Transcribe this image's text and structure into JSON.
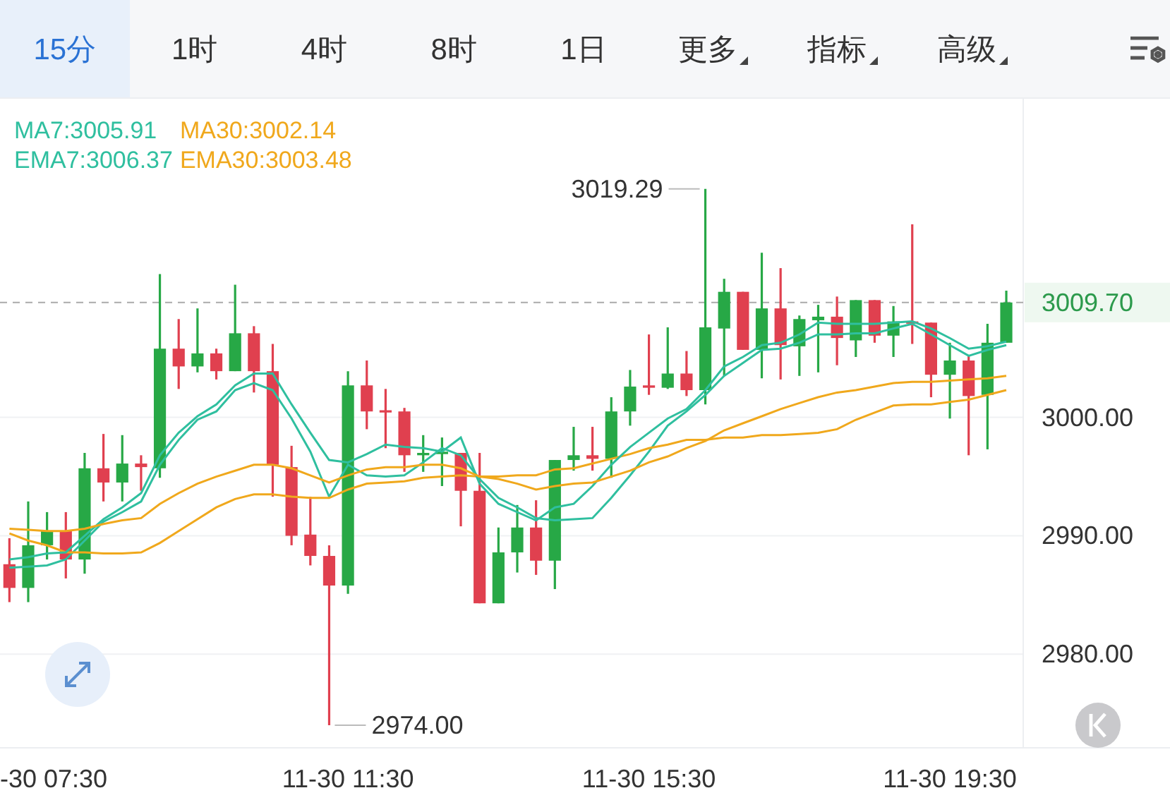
{
  "tabs": [
    {
      "label": "15分",
      "selected": true,
      "dropdown": false
    },
    {
      "label": "1时",
      "selected": false,
      "dropdown": false
    },
    {
      "label": "4时",
      "selected": false,
      "dropdown": false
    },
    {
      "label": "8时",
      "selected": false,
      "dropdown": false
    },
    {
      "label": "1日",
      "selected": false,
      "dropdown": false
    },
    {
      "label": "更多",
      "selected": false,
      "dropdown": true
    },
    {
      "label": "指标",
      "selected": false,
      "dropdown": true
    },
    {
      "label": "高级",
      "selected": false,
      "dropdown": true
    }
  ],
  "chart": {
    "chart_data": {
      "type": "candlestick",
      "grid": true,
      "categories": [
        null,
        null,
        "-30 07:30",
        null,
        null,
        null,
        null,
        null,
        null,
        null,
        null,
        null,
        null,
        null,
        null,
        null,
        null,
        null,
        "11-30 11:30",
        null,
        null,
        null,
        null,
        null,
        null,
        null,
        null,
        null,
        null,
        null,
        null,
        null,
        null,
        null,
        "11-30 15:30",
        null,
        null,
        null,
        null,
        null,
        null,
        null,
        null,
        null,
        null,
        null,
        null,
        null,
        null,
        null,
        "11-30 19:30",
        null,
        null,
        null
      ],
      "ylim": [
        2972.1,
        3026.9
      ],
      "yticks": [
        {
          "value": 2980,
          "label": "2980.00"
        },
        {
          "value": 2990,
          "label": "2990.00"
        },
        {
          "value": 3000,
          "label": "3000.00"
        }
      ],
      "ohlc": [
        [
          2987.6,
          2989.8,
          2984.4,
          2985.6
        ],
        [
          2985.6,
          2992.9,
          2984.4,
          2989.2
        ],
        [
          2989.2,
          2992.0,
          2988.0,
          2990.4
        ],
        [
          2990.4,
          2992.0,
          2986.4,
          2988.0
        ],
        [
          2988.0,
          2997.0,
          2986.8,
          2995.7
        ],
        [
          2995.7,
          2998.6,
          2992.9,
          2994.5
        ],
        [
          2994.5,
          2998.5,
          2992.9,
          2996.1
        ],
        [
          2996.1,
          2996.8,
          2993.8,
          2995.8
        ],
        [
          2995.7,
          3012.1,
          2994.9,
          3005.8
        ],
        [
          3005.8,
          3008.3,
          3002.4,
          3004.3
        ],
        [
          3004.3,
          3009.2,
          3003.8,
          3005.4
        ],
        [
          3005.4,
          3005.8,
          3003.2,
          3003.9
        ],
        [
          3003.9,
          3011.2,
          3003.9,
          3007.1
        ],
        [
          3007.1,
          3007.7,
          3002.1,
          3003.9
        ],
        [
          3003.9,
          3006.2,
          2993.3,
          2996.0
        ],
        [
          2995.8,
          2997.6,
          2989.2,
          2990.0
        ],
        [
          2990.1,
          2993.3,
          2987.5,
          2988.3
        ],
        [
          2988.3,
          2989.2,
          2974.0,
          2985.8
        ],
        [
          2985.8,
          3003.9,
          2985.1,
          3002.7
        ],
        [
          3002.7,
          3004.8,
          2999.0,
          3000.5
        ],
        [
          3000.6,
          3002.4,
          2997.4,
          3000.5
        ],
        [
          3000.5,
          3000.8,
          2995.4,
          2996.8
        ],
        [
          2996.8,
          2998.5,
          2995.4,
          2997.0
        ],
        [
          2996.9,
          2998.3,
          2994.2,
          2997.1
        ],
        [
          2997.0,
          2997.0,
          2990.8,
          2993.8
        ],
        [
          2993.8,
          2997.0,
          2984.3,
          2984.3
        ],
        [
          2984.3,
          2990.7,
          2984.3,
          2988.6
        ],
        [
          2988.6,
          2992.6,
          2986.9,
          2990.7
        ],
        [
          2990.7,
          2993.0,
          2986.7,
          2987.9
        ],
        [
          2987.9,
          2996.4,
          2985.5,
          2996.4
        ],
        [
          2996.4,
          2999.2,
          2995.5,
          2996.8
        ],
        [
          2996.8,
          2999.2,
          2995.5,
          2996.5
        ],
        [
          2996.5,
          3001.7,
          2994.9,
          3000.5
        ],
        [
          3000.5,
          3004.0,
          2999.3,
          3002.6
        ],
        [
          3002.7,
          3007.0,
          3001.9,
          3002.5
        ],
        [
          3002.5,
          3007.6,
          3002.4,
          3003.7
        ],
        [
          3003.7,
          3005.6,
          3001.8,
          3002.3
        ],
        [
          3002.3,
          3019.29,
          3001.1,
          3007.6
        ],
        [
          3007.5,
          3011.7,
          3003.5,
          3010.6
        ],
        [
          3010.6,
          3010.6,
          3005.7,
          3005.7
        ],
        [
          3005.7,
          3013.9,
          3003.3,
          3009.2
        ],
        [
          3009.2,
          3012.6,
          3003.2,
          3006.1
        ],
        [
          3006.0,
          3008.6,
          3003.5,
          3008.3
        ],
        [
          3008.2,
          3009.5,
          3003.8,
          3008.5
        ],
        [
          3008.5,
          3010.2,
          3004.4,
          3006.7
        ],
        [
          3006.5,
          3009.9,
          3005.1,
          3009.9
        ],
        [
          3009.9,
          3009.9,
          3006.3,
          3006.9
        ],
        [
          3006.9,
          3009.4,
          3005.1,
          3008.1
        ],
        [
          3008.1,
          3016.3,
          3006.2,
          3008.0
        ],
        [
          3008.0,
          3008.0,
          3001.7,
          3003.6
        ],
        [
          3003.6,
          3006.3,
          2999.9,
          3004.8
        ],
        [
          3004.8,
          3005.2,
          2996.8,
          3001.8
        ],
        [
          3001.9,
          3007.9,
          2997.3,
          3006.3
        ],
        [
          3006.3,
          3010.7,
          3006.3,
          3009.7
        ]
      ],
      "series": [
        {
          "type": "line",
          "name": "MA7:3005.91",
          "color": "#2fbf9f",
          "values": [
            2987.3,
            2987.4,
            2987.5,
            2988.0,
            2989.6,
            2991.2,
            2992.0,
            2992.9,
            2996.0,
            2998.1,
            2999.8,
            3000.5,
            3002.3,
            3002.9,
            3002.3,
            2999.9,
            2997.1,
            2993.3,
            2996.0,
            2995.1,
            2995.0,
            2995.1,
            2996.2,
            2997.4,
            2996.8,
            2994.8,
            2993.2,
            2992.4,
            2991.5,
            2991.3,
            2991.4,
            2991.5,
            2993.2,
            2995.1,
            2997.1,
            2999.3,
            3000.5,
            3001.9,
            3003.5,
            3004.6,
            3005.7,
            3005.8,
            3006.3,
            3007.0,
            3007.0,
            3007.1,
            3007.1,
            3007.5,
            3007.9,
            3007.0,
            3006.1,
            3005.2,
            3005.7,
            3006.1
          ]
        },
        {
          "type": "line",
          "name": "MA30:3002.14",
          "color": "#f0a81c",
          "values": [
            2990.2,
            2989.6,
            2989.2,
            2988.6,
            2988.6,
            2988.5,
            2988.5,
            2988.6,
            2989.4,
            2990.4,
            2991.4,
            2992.4,
            2993.1,
            2993.5,
            2993.5,
            2993.3,
            2993.2,
            2993.2,
            2993.9,
            2994.4,
            2994.5,
            2994.6,
            2994.9,
            2995.0,
            2995.1,
            2995.0,
            2995.0,
            2995.1,
            2995.1,
            2995.6,
            2995.7,
            2996.1,
            2996.5,
            2996.9,
            2997.4,
            2997.7,
            2998.1,
            2998.1,
            2998.3,
            2998.3,
            2998.5,
            2998.5,
            2998.6,
            2998.7,
            2999.0,
            2999.8,
            3000.4,
            3001.0,
            3001.1,
            3001.1,
            3001.3,
            3001.5,
            3001.9,
            3002.3
          ]
        },
        {
          "type": "line",
          "name": "EMA7:3006.37",
          "color": "#2fbf9f",
          "values": [
            2988.0,
            2988.2,
            2988.5,
            2988.6,
            2990.0,
            2991.4,
            2992.4,
            2993.6,
            2996.8,
            2998.7,
            3000.1,
            3001.1,
            3002.7,
            3003.7,
            3003.7,
            3001.1,
            2998.7,
            2996.4,
            2996.2,
            2996.9,
            2997.7,
            2997.5,
            2997.4,
            2997.1,
            2998.3,
            2994.4,
            2992.7,
            2992.0,
            2991.3,
            2992.4,
            2992.7,
            2994.2,
            2996.0,
            2997.5,
            2998.7,
            2999.9,
            3000.7,
            3002.3,
            3004.3,
            3005.1,
            3006.1,
            3006.3,
            3007.0,
            3008.0,
            3007.9,
            3007.9,
            3007.9,
            3008.0,
            3008.1,
            3007.5,
            3006.7,
            3005.8,
            3006.0,
            3006.4
          ]
        },
        {
          "type": "line",
          "name": "EMA30:3003.48",
          "color": "#f0a81c",
          "values": [
            2990.6,
            2990.5,
            2990.4,
            2990.4,
            2990.6,
            2991.0,
            2991.3,
            2991.5,
            2992.7,
            2993.6,
            2994.4,
            2995.0,
            2995.5,
            2996.0,
            2996.0,
            2995.7,
            2995.1,
            2994.5,
            2995.1,
            2995.6,
            2995.8,
            2995.8,
            2996.0,
            2996.0,
            2995.7,
            2995.0,
            2994.8,
            2994.4,
            2993.9,
            2994.2,
            2994.4,
            2994.5,
            2995.0,
            2995.5,
            2996.2,
            2996.7,
            2997.4,
            2998.0,
            2998.9,
            2999.5,
            3000.1,
            3000.7,
            3001.2,
            3001.7,
            3002.1,
            3002.3,
            3002.6,
            3002.9,
            3003.0,
            3003.0,
            3003.1,
            3003.2,
            3003.3,
            3003.5
          ]
        }
      ],
      "ref_lines": [
        {
          "axis": "y",
          "value": 3009.7,
          "label": "3009.70"
        }
      ],
      "annotations": [
        "3019.29",
        "2974.00"
      ]
    }
  }
}
